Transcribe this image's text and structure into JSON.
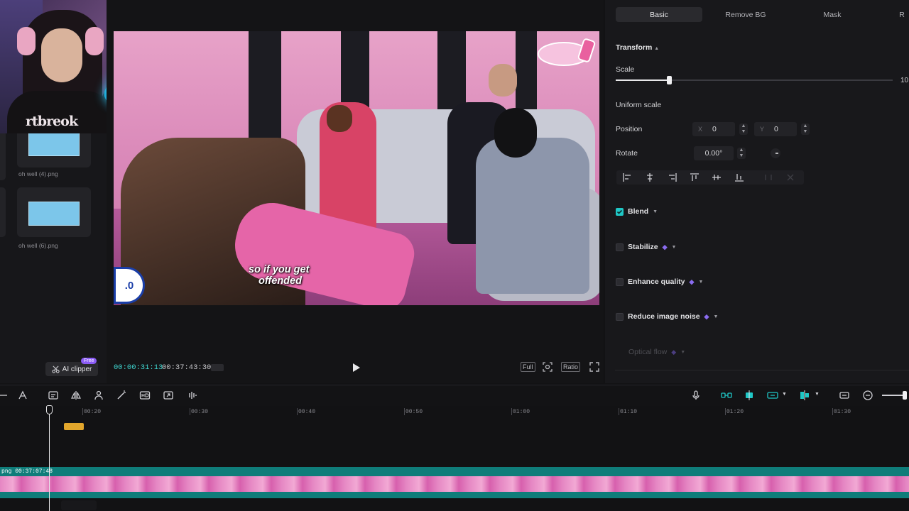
{
  "media": {
    "items": [
      {
        "name": "oh well (4).png"
      },
      {
        "name": "oh well (6).png"
      }
    ],
    "ai_clipper_label": "AI clipper",
    "free_badge": "Free"
  },
  "webcam": {
    "shirt_text": "rtbreok"
  },
  "player": {
    "subtitle_line1": "so if you get",
    "subtitle_line2": "offended",
    "score_badge": ".0",
    "current_time": "00:00:31:13",
    "duration": "00:37:43:30",
    "full_label": "Full",
    "ratio_label": "Ratio"
  },
  "props": {
    "tabs": [
      "Basic",
      "Remove BG",
      "Mask"
    ],
    "active_tab": "Basic",
    "transform_label": "Transform",
    "scale_label": "Scale",
    "scale_value_partial": "10",
    "uniform_scale_label": "Uniform scale",
    "position_label": "Position",
    "pos_x_axis": "X",
    "pos_x": "0",
    "pos_y_axis": "Y",
    "pos_y": "0",
    "rotate_label": "Rotate",
    "rotate_value": "0.00°",
    "options": [
      {
        "label": "Blend",
        "checked": true
      },
      {
        "label": "Stabilize",
        "checked": false
      },
      {
        "label": "Enhance quality",
        "checked": false
      },
      {
        "label": "Reduce image noise",
        "checked": false
      }
    ],
    "optical_flow_label": "Optical flow"
  },
  "timeline": {
    "ticks": [
      "00:20",
      "00:30",
      "00:40",
      "00:50",
      "01:00",
      "01:10",
      "01:20",
      "01:30"
    ],
    "track_label": "png 00:37:07:48"
  },
  "colors": {
    "accent": "#1fc7c6",
    "track": "#0f7d7a",
    "premium": "#8b5cf6"
  }
}
